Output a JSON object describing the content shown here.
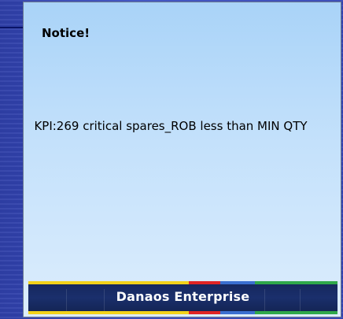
{
  "notice": {
    "title": "Notice!",
    "message": "KPI:269 critical spares_ROB less than MIN QTY"
  },
  "footer": {
    "brand": "Danaos Enterprise",
    "stripe_colors": {
      "left": "#f2d21a",
      "middle": "#e02424",
      "center_right": "#3a6fd0",
      "right": "#2fa84a"
    }
  },
  "pointer": {
    "icon": "arrow-right-icon"
  }
}
